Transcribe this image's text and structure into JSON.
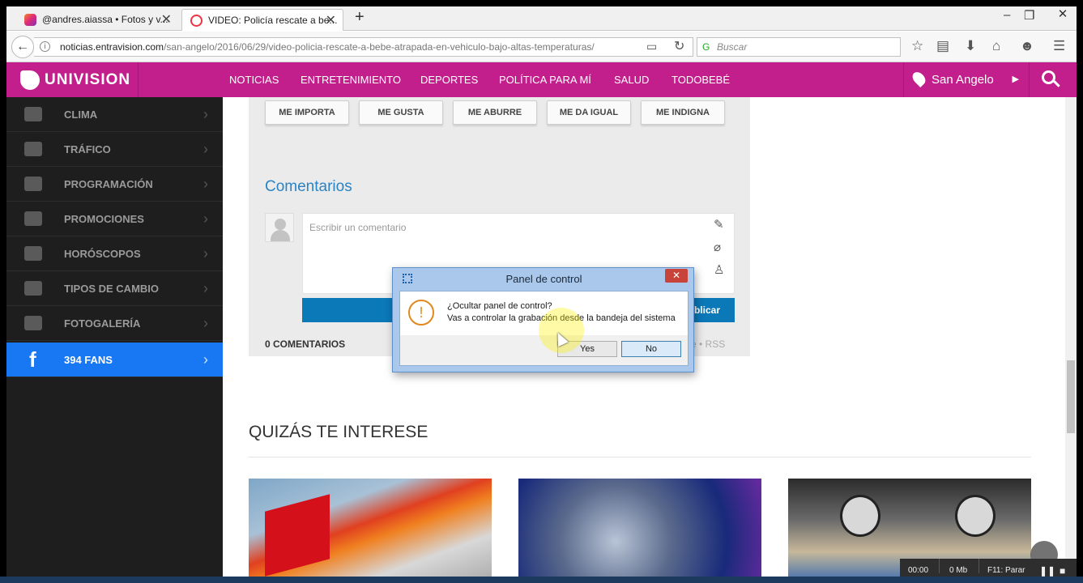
{
  "browser": {
    "tabs": [
      {
        "label": "@andres.aiassa • Fotos y v..."
      },
      {
        "label": "VIDEO: Policía rescate a be..."
      }
    ],
    "url_domain": "noticias.entravision.com",
    "url_path": "/san-angelo/2016/06/29/video-policia-rescate-a-bebe-atrapada-en-vehiculo-bajo-altas-temperaturas/",
    "search_placeholder": "Buscar"
  },
  "site": {
    "logo": "UNIVISION",
    "nav": [
      "NOTICIAS",
      "ENTRETENIMIENTO",
      "DEPORTES",
      "POLÍTICA PARA MÍ",
      "SALUD",
      "TODOBEBÉ"
    ],
    "location": "San Angelo"
  },
  "sidebar": {
    "items": [
      {
        "label": "CLIMA",
        "icon": "weather-icon"
      },
      {
        "label": "TRÁFICO",
        "icon": "traffic-light-icon"
      },
      {
        "label": "PROGRAMACIÓN",
        "icon": "menu-icon"
      },
      {
        "label": "PROMOCIONES",
        "icon": "gear-icon"
      },
      {
        "label": "HORÓSCOPOS",
        "icon": "horoscope-icon"
      },
      {
        "label": "TIPOS DE CAMBIO",
        "icon": "dollar-icon"
      },
      {
        "label": "FOTOGALERÍA",
        "icon": "camera-icon"
      },
      {
        "label": "394 FANS",
        "icon": "facebook-icon",
        "active": true
      }
    ]
  },
  "reactions": [
    "ME IMPORTA",
    "ME GUSTA",
    "ME ABURRE",
    "ME DA IGUAL",
    "ME INDIGNA"
  ],
  "comments": {
    "title": "Comentarios",
    "placeholder": "Escribir un comentario",
    "publish": "ublicar",
    "count": "0 COMENTARIOS",
    "rss": "rse • RSS"
  },
  "related": {
    "title": "QUIZÁS TE INTERESE"
  },
  "dialog": {
    "title": "Panel de control",
    "question": "¿Ocultar panel de control?",
    "detail": "Vas a controlar la grabación desde la bandeja del sistema",
    "yes": "Yes",
    "no": "No"
  },
  "recorder": {
    "time": "00:00",
    "size": "0 Mb",
    "stop": "F11: Parar"
  }
}
